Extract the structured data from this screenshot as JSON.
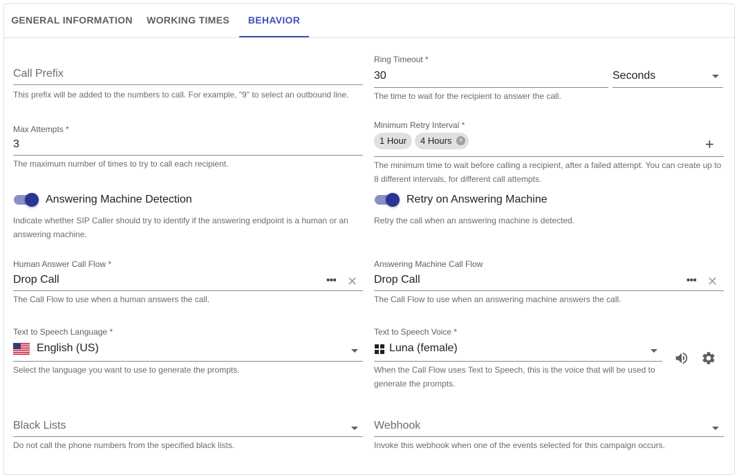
{
  "tabs": [
    {
      "label": "GENERAL INFORMATION",
      "active": false
    },
    {
      "label": "WORKING TIMES",
      "active": false
    },
    {
      "label": "BEHAVIOR",
      "active": true
    }
  ],
  "call_prefix": {
    "placeholder": "Call Prefix",
    "value": "",
    "help": "This prefix will be added to the numbers to call. For example, \"9\" to select an outbound line."
  },
  "ring_timeout": {
    "label": "Ring Timeout *",
    "value": "30",
    "unit": "Seconds",
    "help": "The time to wait for the recipient to answer the call."
  },
  "max_attempts": {
    "label": "Max Attempts *",
    "value": "3",
    "help": "The maximum number of times to try to call each recipient."
  },
  "min_retry_interval": {
    "label": "Minimum Retry Interval *",
    "chips": [
      "1 Hour",
      "4 Hours"
    ],
    "help": "The minimum time to wait before calling a recipient, after a failed attempt. You can create up to 8 different intervals, for different call attempts."
  },
  "answering_machine_detection": {
    "label": "Answering Machine Detection",
    "enabled": true,
    "help": "Indicate whether SIP Caller should try to identify if the answering endpoint is a human or an answering machine."
  },
  "retry_on_answering_machine": {
    "label": "Retry on Answering Machine",
    "enabled": true,
    "help": "Retry the call when an answering machine is detected."
  },
  "human_answer_call_flow": {
    "label": "Human Answer Call Flow *",
    "value": "Drop Call",
    "help": "The Call Flow to use when a human answers the call."
  },
  "answering_machine_call_flow": {
    "label": "Answering Machine Call Flow",
    "value": "Drop Call",
    "help": "The Call Flow to use when an answering machine answers the call."
  },
  "tts_language": {
    "label": "Text to Speech Language *",
    "value": "English (US)",
    "icon": "us-flag-icon",
    "help": "Select the language you want to use to generate the prompts."
  },
  "tts_voice": {
    "label": "Text to Speech Voice *",
    "value": "Luna (female)",
    "icon": "windows-icon",
    "help": "When the Call Flow uses Text to Speech, this is the voice that will be used to generate the prompts."
  },
  "black_lists": {
    "placeholder": "Black Lists",
    "help": "Do not call the phone numbers from the specified black lists."
  },
  "webhook": {
    "placeholder": "Webhook",
    "help": "Invoke this webhook when one of the events selected for this campaign occurs."
  },
  "colors": {
    "accent": "#3f51b5",
    "switch_thumb": "#283593",
    "switch_track": "#8890c8"
  }
}
